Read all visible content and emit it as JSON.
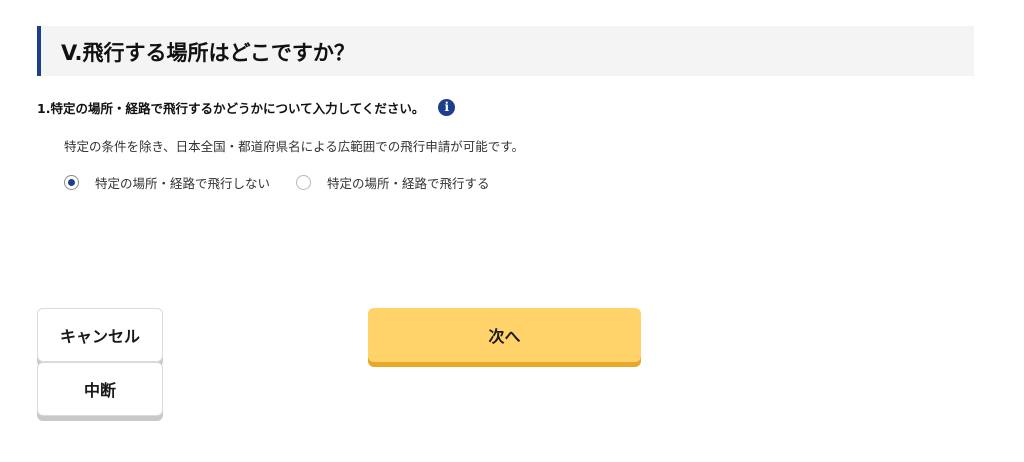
{
  "section": {
    "title": "V.飛行する場所はどこですか？"
  },
  "question": {
    "label": "1.特定の場所・経路で飛行するかどうかについて入力してください。",
    "info_icon": "info-icon"
  },
  "description": "特定の条件を除き、日本全国・都道府県名による広範囲での飛行申請が可能です。",
  "radio_options": [
    {
      "label": "特定の場所・経路で飛行しない",
      "checked": true
    },
    {
      "label": "特定の場所・経路で飛行する",
      "checked": false
    }
  ],
  "buttons": {
    "cancel": "キャンセル",
    "suspend": "中断",
    "next": "次へ"
  },
  "colors": {
    "accent_navy": "#1d3f8a",
    "next_button": "#ffd26a",
    "header_bg": "#f4f4f4"
  }
}
